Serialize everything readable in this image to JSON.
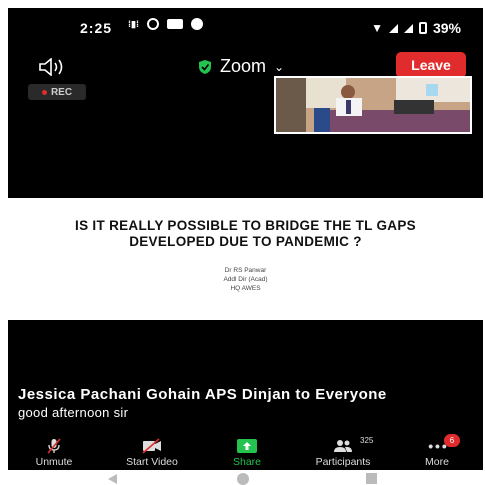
{
  "status_bar": {
    "time": "2:25",
    "battery": "39%"
  },
  "meeting": {
    "title": "Zoom",
    "leave_label": "Leave",
    "rec_label": "REC"
  },
  "slide": {
    "title": "IS IT REALLY POSSIBLE TO BRIDGE THE TL GAPS DEVELOPED DUE TO PANDEMIC ?",
    "author": "Dr RS Panwar",
    "role": "Addl Dir (Acad)",
    "org": "HQ AWES"
  },
  "chat": {
    "sender": "Jessica Pachani Gohain APS Dinjan to Everyone",
    "message": "good afternoon sir"
  },
  "toolbar": {
    "unmute": "Unmute",
    "start_video": "Start Video",
    "share": "Share",
    "participants": "Participants",
    "participants_count": "325",
    "more": "More",
    "more_badge": "6"
  },
  "colors": {
    "leave": "#e02c2c",
    "share": "#24c24e",
    "background": "#000000"
  },
  "icons": [
    "speaker-icon",
    "shield-icon",
    "chevron-down-icon",
    "mic-off-icon",
    "video-off-icon",
    "share-icon",
    "participants-icon",
    "more-icon"
  ]
}
